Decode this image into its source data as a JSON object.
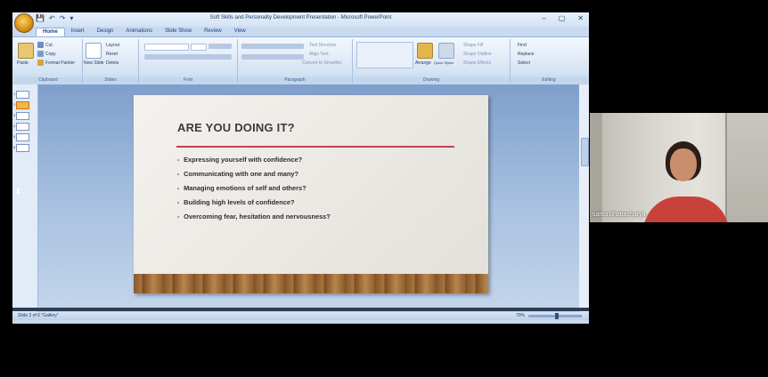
{
  "window": {
    "title": "Soft Skills and Personality Development  Presentation - Microsoft PowerPoint",
    "controls": [
      "–",
      "▢",
      "✕"
    ]
  },
  "quick_access": [
    "💾",
    "↶",
    "↷",
    "▾"
  ],
  "ribbon": {
    "tabs": [
      "Home",
      "Insert",
      "Design",
      "Animations",
      "Slide Show",
      "Review",
      "View"
    ],
    "active_tab": "Home",
    "groups": {
      "clipboard": {
        "label": "Clipboard",
        "paste": "Paste",
        "cut": "Cut",
        "copy": "Copy",
        "format_painter": "Format Painter"
      },
      "slides": {
        "label": "Slides",
        "new_slide": "New Slide",
        "layout": "Layout",
        "reset": "Reset",
        "delete": "Delete"
      },
      "font": {
        "label": "Font"
      },
      "paragraph": {
        "label": "Paragraph",
        "text_direction": "Text Direction",
        "align_text": "Align Text",
        "convert_smartart": "Convert to SmartArt"
      },
      "drawing": {
        "label": "Drawing",
        "arrange": "Arrange",
        "quick_styles": "Quick Styles",
        "shape_fill": "Shape Fill",
        "shape_outline": "Shape Outline",
        "shape_effects": "Shape Effects"
      },
      "editing": {
        "label": "Editing",
        "find": "Find",
        "replace": "Replace",
        "select": "Select"
      }
    }
  },
  "outline": {
    "thumbnails": [
      "1",
      "2",
      "3",
      "4",
      "5",
      "6"
    ],
    "selected": "2"
  },
  "slide": {
    "title": "ARE YOU DOING IT?",
    "bullets": [
      "Expressing yourself with confidence?",
      "Communicating with one and many?",
      "Managing emotions of self and others?",
      "Building high levels of confidence?",
      "Overcoming fear, hesitation and nervousness?"
    ]
  },
  "status": {
    "left": "Slide 2 of 6   \"Gallery\"",
    "zoom": "70%"
  },
  "webcam": {
    "participant_name": "sarita bhattacharya"
  }
}
